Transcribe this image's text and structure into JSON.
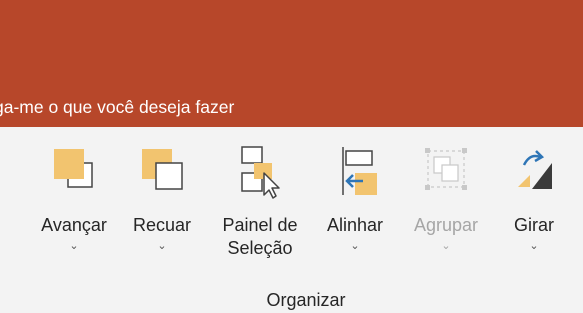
{
  "tell_me": {
    "text": "ga-me o que você deseja fazer"
  },
  "group": {
    "label": "Organizar"
  },
  "commands": {
    "avancar": {
      "label": "Avançar",
      "chevron": "⌄",
      "icon": "bring-forward-icon"
    },
    "recuar": {
      "label": "Recuar",
      "chevron": "⌄",
      "icon": "send-backward-icon"
    },
    "painel": {
      "label_line1": "Painel de",
      "label_line2": "Seleção",
      "icon": "selection-pane-icon"
    },
    "alinhar": {
      "label": "Alinhar",
      "chevron": "⌄",
      "icon": "align-icon"
    },
    "agrupar": {
      "label": "Agrupar",
      "chevron": "⌄",
      "icon": "group-icon",
      "enabled": false
    },
    "girar": {
      "label": "Girar",
      "chevron": "⌄",
      "icon": "rotate-icon"
    }
  },
  "colors": {
    "title_bar": "#b7472a",
    "ribbon": "#f3f3f3",
    "shape_fill": "#f2c46f",
    "accent_blue": "#2e75b6"
  }
}
